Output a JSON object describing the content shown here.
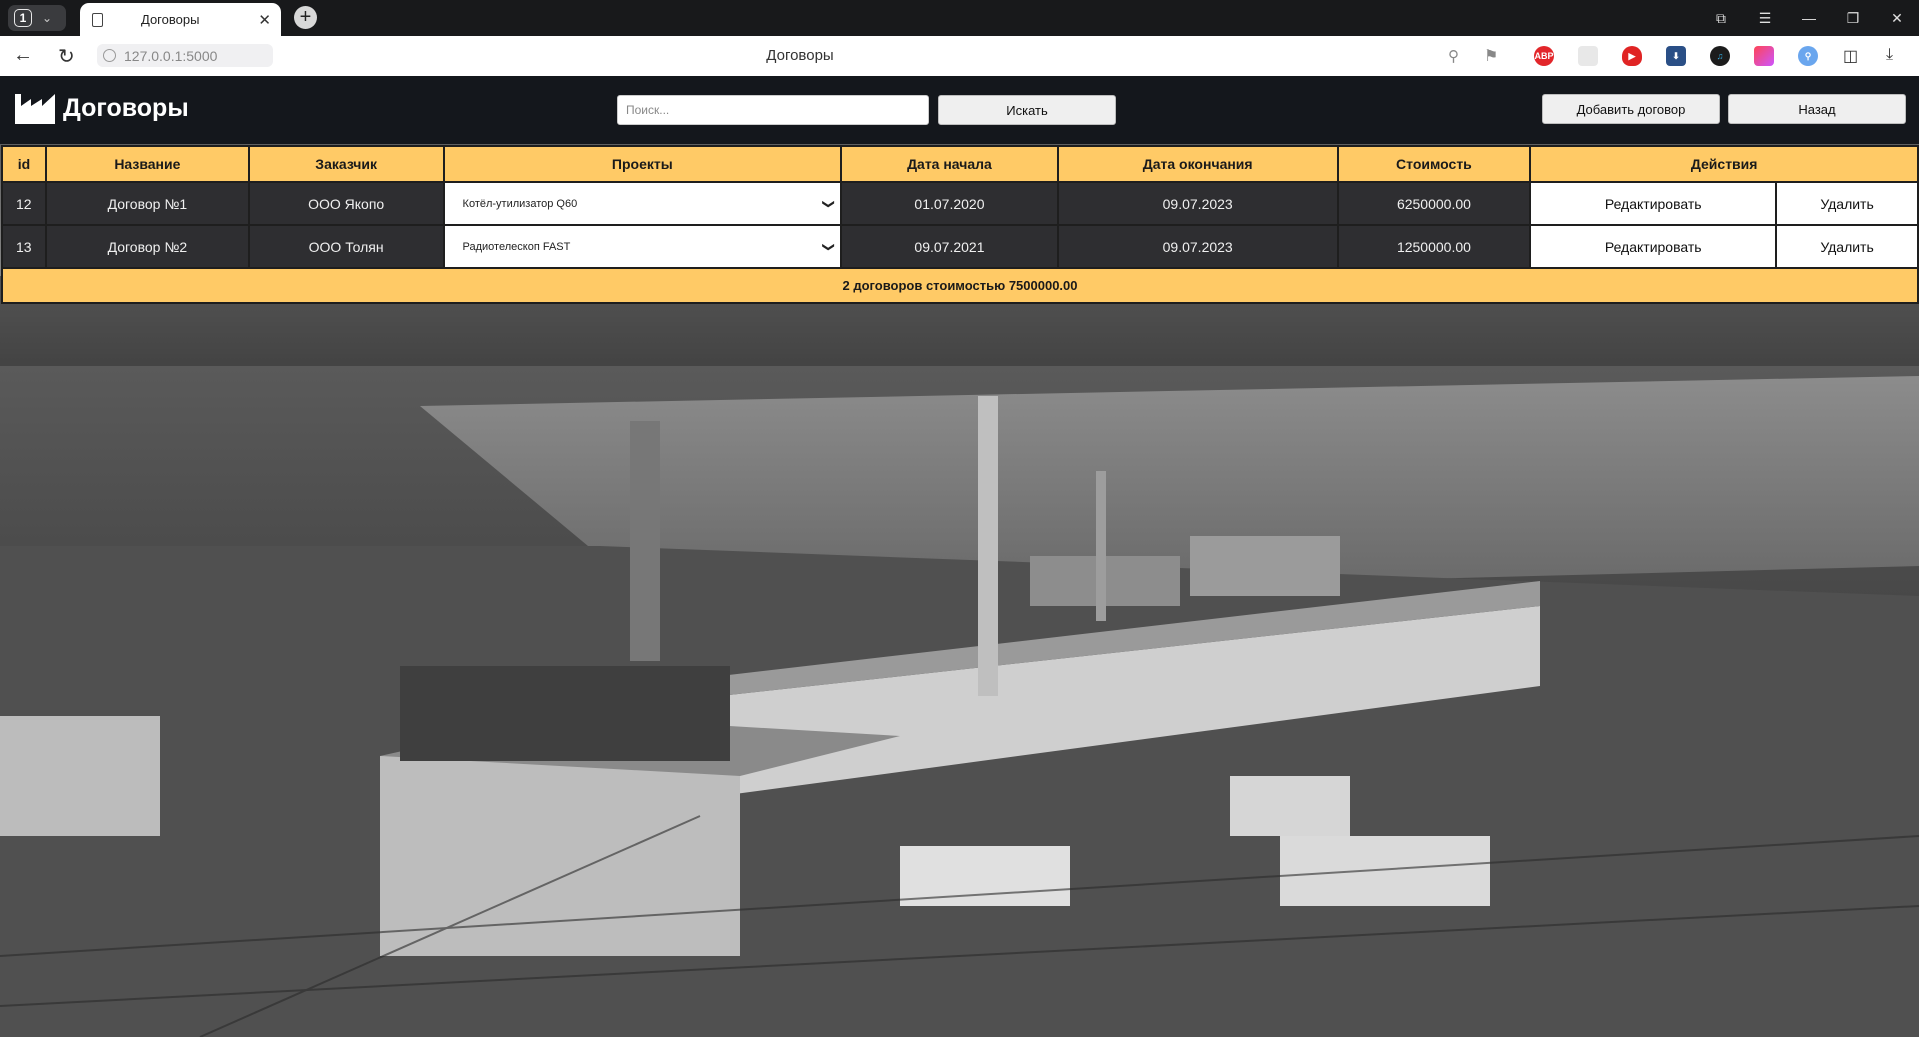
{
  "browser": {
    "tab_count": "1",
    "tab_title": "Договоры",
    "url": "127.0.0.1:5000",
    "page_title": "Договоры"
  },
  "header": {
    "title": "Договоры",
    "search_placeholder": "Поиск...",
    "search_button": "Искать",
    "add_button": "Добавить договор",
    "back_button": "Назад"
  },
  "table": {
    "columns": [
      "id",
      "Название",
      "Заказчик",
      "Проекты",
      "Дата начала",
      "Дата окончания",
      "Стоимость",
      "Действия"
    ],
    "rows": [
      {
        "id": "12",
        "name": "Договор №1",
        "customer": "ООО Якопо",
        "project": "Котёл-утилизатор Q60",
        "start": "01.07.2020",
        "end": "09.07.2023",
        "cost": "6250000.00",
        "edit": "Редактировать",
        "delete": "Удалить"
      },
      {
        "id": "13",
        "name": "Договор №2",
        "customer": "ООО Толян",
        "project": "Радиотелескоп FAST",
        "start": "09.07.2021",
        "end": "09.07.2023",
        "cost": "1250000.00",
        "edit": "Редактировать",
        "delete": "Удалить"
      }
    ],
    "summary": "2 договоров стоимостью 7500000.00"
  },
  "colors": {
    "header_bg": "#14171c",
    "table_accent": "#ffca66",
    "row_bg": "#2e2e31"
  }
}
